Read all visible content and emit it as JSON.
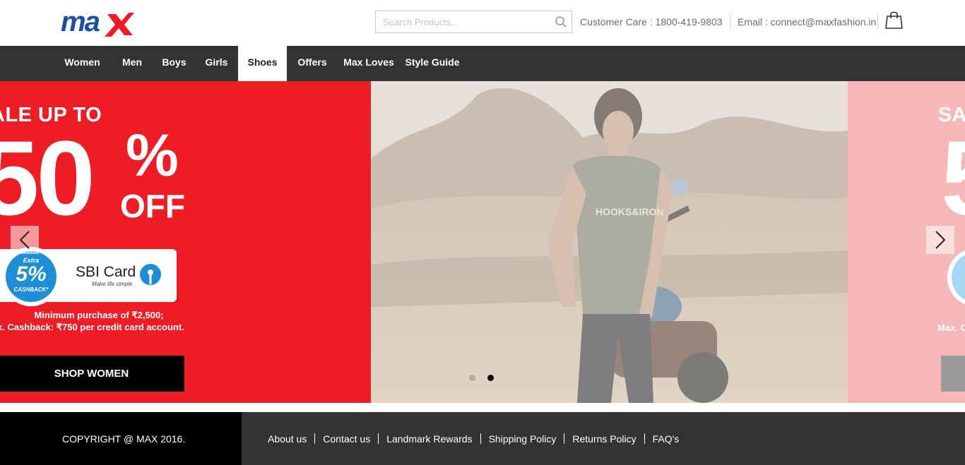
{
  "header": {
    "logo_text": "max",
    "search_placeholder": "Search Products...",
    "customer_care": "Customer Care : 1800-419-9803",
    "email": "Email : connect@maxfashion.in"
  },
  "nav": {
    "items": [
      {
        "label": "Women"
      },
      {
        "label": "Men"
      },
      {
        "label": "Boys"
      },
      {
        "label": "Girls"
      },
      {
        "label": "Shoes"
      },
      {
        "label": "Offers"
      },
      {
        "label": "Max Loves"
      },
      {
        "label": "Style Guide"
      }
    ],
    "active_label": "Shoes"
  },
  "banner": {
    "left_slide": {
      "headline": "ALE UP TO",
      "amount": "50",
      "percent_sign": "%",
      "off_text": "OFF",
      "cashback_extra": "Extra",
      "cashback_percent": "5%",
      "cashback_word": "CASHBACK*",
      "card_name": "SBI Card",
      "card_tagline": "Make life simple",
      "min_purchase": "Minimum purchase of ₹2,500;",
      "max_cashback": "x. Cashback: ₹750 per credit card account.",
      "cta": "SHOP WOMEN"
    },
    "right_slide": {
      "headline": "SA",
      "amount": "5",
      "max_text": "Max. C"
    },
    "active_dot": 2,
    "dot_count": 2
  },
  "footer": {
    "copyright": "COPYRIGHT @ MAX 2016.",
    "links": [
      {
        "label": "About us"
      },
      {
        "label": "Contact us"
      },
      {
        "label": "Landmark Rewards"
      },
      {
        "label": "Shipping Policy"
      },
      {
        "label": "Returns Policy"
      },
      {
        "label": "FAQ's"
      }
    ]
  },
  "colors": {
    "brand_red": "#ee1c25",
    "brand_blue": "#1a4fa1",
    "nav_bg": "#333333",
    "footer_black": "#000000",
    "cashback_blue": "#1e8fd6"
  }
}
